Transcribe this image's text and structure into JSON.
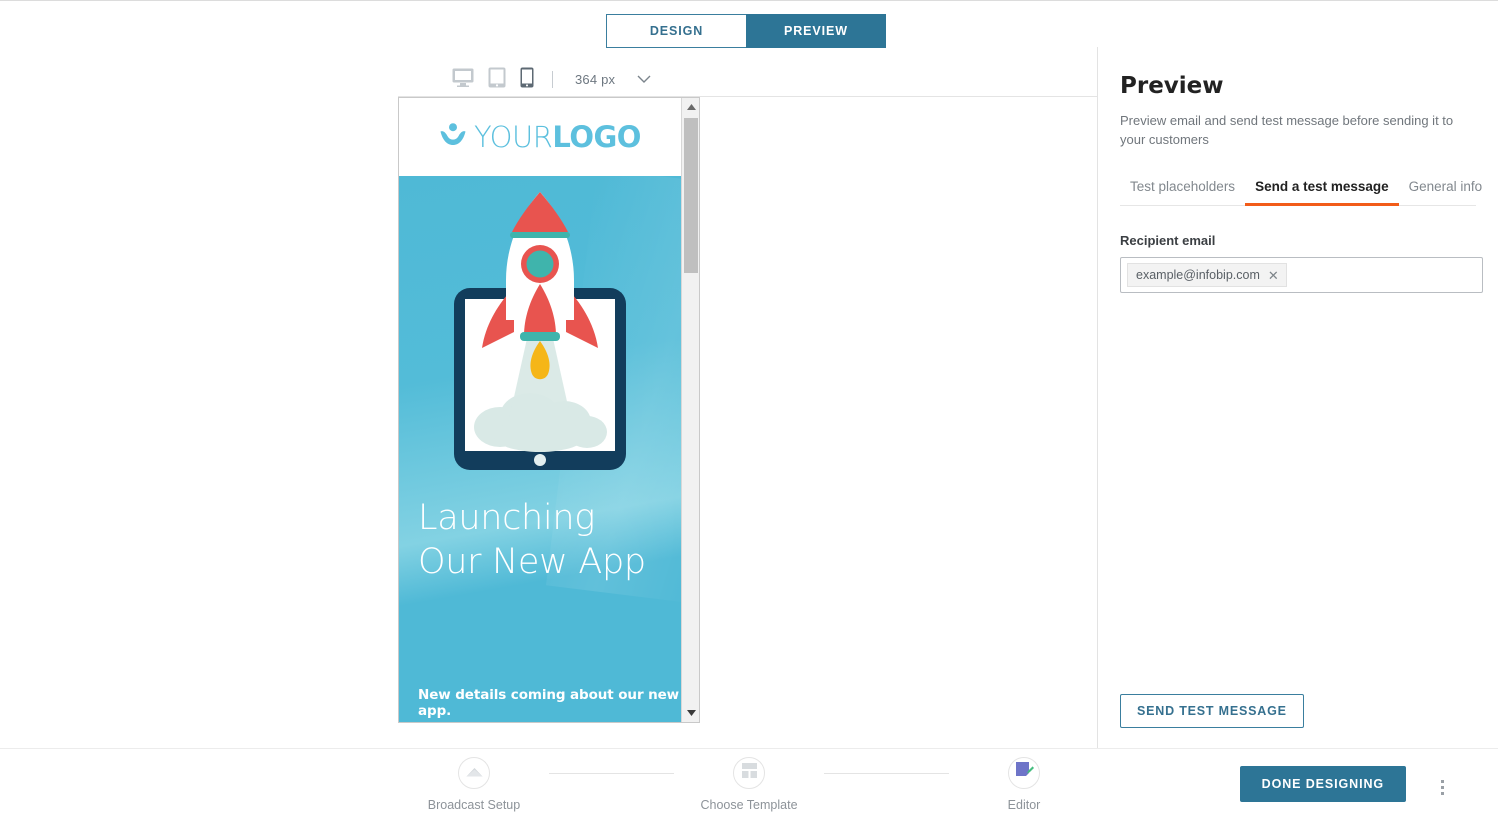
{
  "toggle": {
    "design_label": "DESIGN",
    "preview_label": "PREVIEW",
    "active": "PREVIEW"
  },
  "device_toolbar": {
    "desktop_icon": "desktop-icon",
    "tablet_icon": "tablet-icon",
    "mobile_icon": "mobile-icon",
    "selected_device": "mobile",
    "zoom_value": "364 px",
    "chevron_icon": "chevron-down-icon"
  },
  "email_preview": {
    "logo": {
      "mark": "person-icon",
      "text_light": "YOUR",
      "text_bold": "LOGO"
    },
    "hero": {
      "illustration": "rocket-launching-from-tablet-illustration",
      "headline": "Launching Our New App",
      "subtext": "New details coming about our new app.",
      "background_color": "#4fb9d6"
    },
    "scrollbar": {
      "up_arrow_icon": "scroll-up-arrow-icon",
      "down_arrow_icon": "scroll-down-arrow-icon"
    }
  },
  "side_panel": {
    "title": "Preview",
    "description": "Preview email and send test message before sending it to your customers",
    "tabs": [
      {
        "label": "Test placeholders",
        "active": false
      },
      {
        "label": "Send a test message",
        "active": true
      },
      {
        "label": "General info",
        "active": false
      }
    ],
    "accent_color": "#f25c19",
    "recipient": {
      "label": "Recipient email",
      "chips": [
        {
          "value": "example@infobip.com",
          "remove_icon": "close-icon"
        }
      ],
      "placeholder": ""
    },
    "send_button_label": "SEND TEST MESSAGE"
  },
  "bottom_bar": {
    "steps": [
      {
        "label": "Broadcast Setup",
        "icon": "envelope-icon",
        "active": false
      },
      {
        "label": "Choose Template",
        "icon": "grid-layout-icon",
        "active": false
      },
      {
        "label": "Editor",
        "icon": "edit-document-icon",
        "active": true
      }
    ],
    "done_button_label": "DONE DESIGNING",
    "overflow_icon": "kebab-menu-icon"
  }
}
